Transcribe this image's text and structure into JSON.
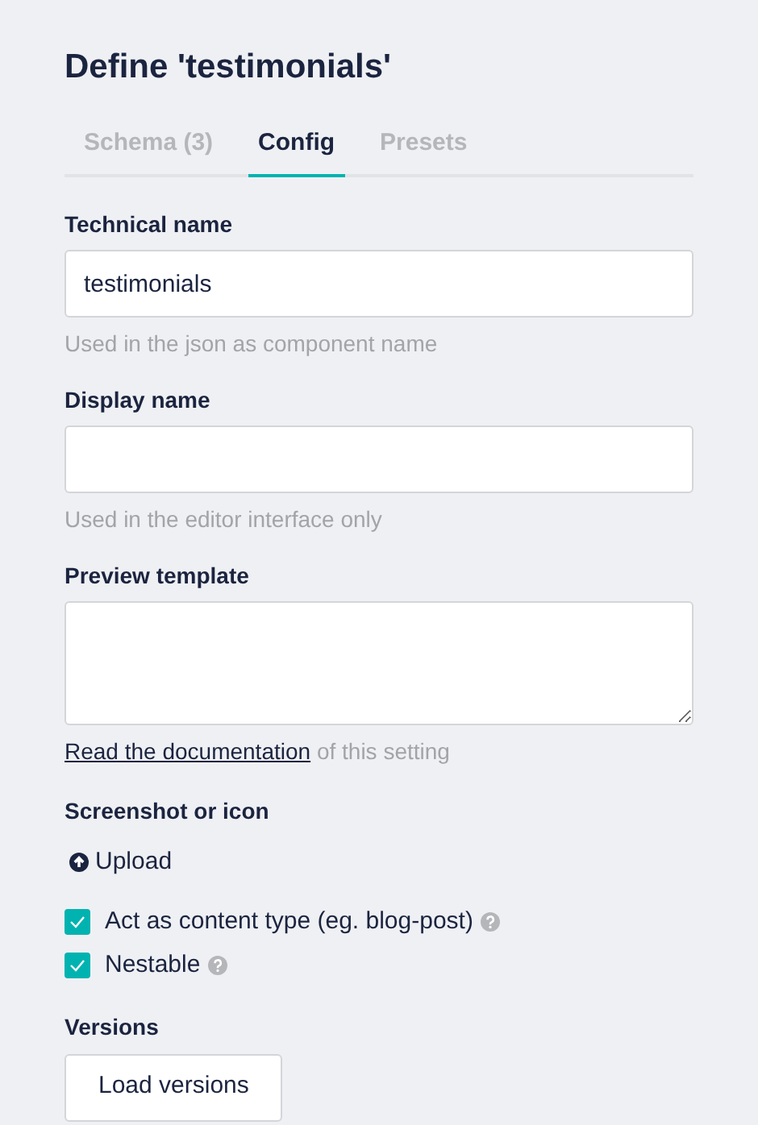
{
  "title": "Define 'testimonials'",
  "tabs": [
    {
      "label": "Schema (3)",
      "selected": false
    },
    {
      "label": "Config",
      "selected": true
    },
    {
      "label": "Presets",
      "selected": false
    }
  ],
  "technical_name": {
    "label": "Technical name",
    "value": "testimonials",
    "hint": "Used in the json as component name"
  },
  "display_name": {
    "label": "Display name",
    "hint": "Used in the editor interface only"
  },
  "preview_template": {
    "label": "Preview template",
    "link": "Read the documentation",
    "hint": "of this setting"
  },
  "screenshot": {
    "label": "Screenshot or icon",
    "button": "Upload"
  },
  "options": [
    {
      "label": "Act as content type (eg. blog-post)",
      "checked": true
    },
    {
      "label": "Nestable",
      "checked": true
    }
  ],
  "versions": {
    "label": "Versions",
    "button": "Load versions"
  }
}
